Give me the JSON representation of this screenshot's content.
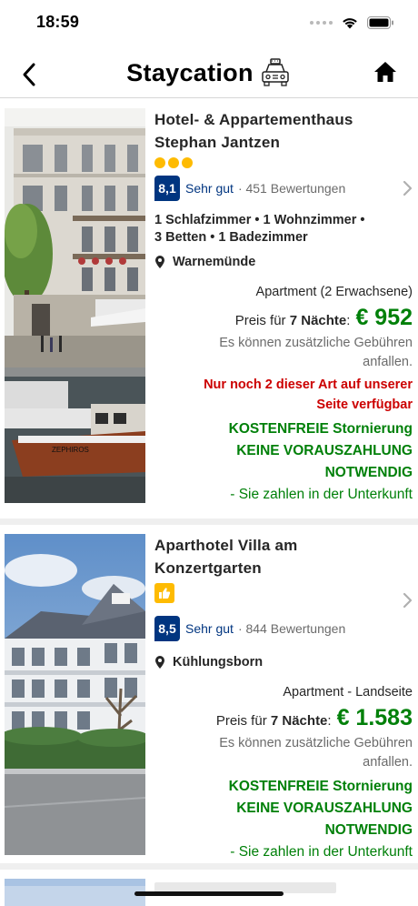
{
  "status_bar": {
    "time": "18:59"
  },
  "nav": {
    "title": "Staycation",
    "title_icon": "taxi-icon",
    "back_icon": "chevron-left-icon",
    "home_icon": "home-icon"
  },
  "colors": {
    "brand_blue": "#003580",
    "price_green": "#008009",
    "alert_red": "#cc0000",
    "star_yellow": "#febb02"
  },
  "results": [
    {
      "name_line1": "Hotel- & Appartementhaus",
      "name_line2": "Stephan Jantzen",
      "stars": 3,
      "score": "8,1",
      "score_word": "Sehr gut",
      "reviews": "· 451 Bewertungen",
      "rooms_line1": "1 Schlafzimmer • 1 Wohnzimmer •",
      "rooms_line2": "3 Betten • 1 Badezimmer",
      "location": "Warnemünde",
      "room_type": "Apartment (2 Erwachsene)",
      "price_prefix": "Preis für",
      "nights": "7 Nächte",
      "price": "€ 952",
      "fees_line1": "Es können zusätzliche Gebühren",
      "fees_line2": "anfallen.",
      "scarcity_line1": "Nur noch 2 dieser Art auf unserer",
      "scarcity_line2": "Seite verfügbar",
      "cancel_line1": "KOSTENFREIE Stornierung",
      "cancel_line2": "KEINE VORAUSZAHLUNG",
      "cancel_line3": "NOTWENDIG",
      "pay_at": "- Sie zahlen in der Unterkunft",
      "boat_label": "ZEPHIROS"
    },
    {
      "name_line1": "Aparthotel Villa am",
      "name_line2": "Konzertgarten",
      "badge_icon": "thumbs-up-icon",
      "score": "8,5",
      "score_word": "Sehr gut",
      "reviews": "· 844 Bewertungen",
      "location": "Kühlungsborn",
      "room_type": "Apartment - Landseite",
      "price_prefix": "Preis für",
      "nights": "7 Nächte",
      "price": "€ 1.583",
      "fees_line1": "Es können zusätzliche Gebühren",
      "fees_line2": "anfallen.",
      "cancel_line1": "KOSTENFREIE Stornierung",
      "cancel_line2": "KEINE VORAUSZAHLUNG",
      "cancel_line3": "NOTWENDIG",
      "pay_at": "- Sie zahlen in der Unterkunft"
    }
  ]
}
